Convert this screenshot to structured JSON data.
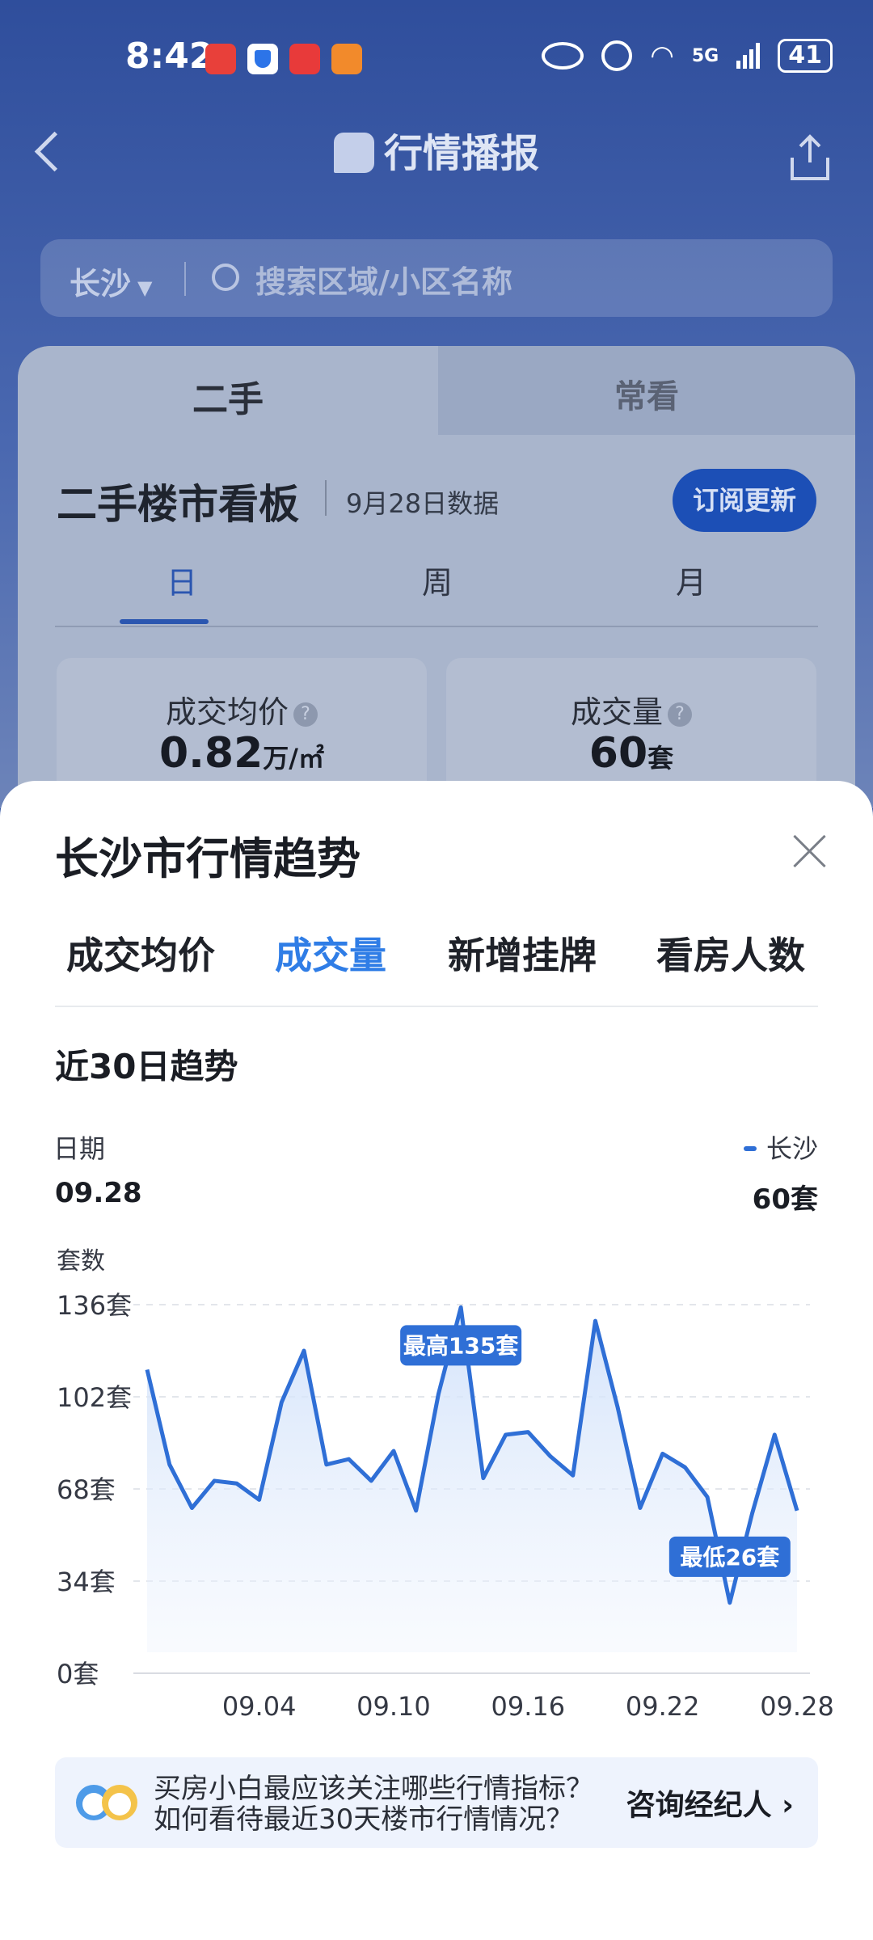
{
  "status_bar": {
    "time": "8:42",
    "network": "5G",
    "battery": "41"
  },
  "header": {
    "title": "行情播报"
  },
  "search": {
    "city": "长沙",
    "placeholder": "搜索区域/小区名称"
  },
  "card": {
    "tabs": [
      {
        "label": "二手"
      },
      {
        "label": "常看"
      }
    ],
    "board_title": "二手楼市看板",
    "board_date": "9月28日数据",
    "subscribe_label": "订阅更新",
    "periods": [
      {
        "label": "日"
      },
      {
        "label": "周"
      },
      {
        "label": "月"
      }
    ],
    "metrics": [
      {
        "label": "成交均价",
        "value": "0.82",
        "unit": "万/㎡"
      },
      {
        "label": "成交量",
        "value": "60",
        "unit": "套"
      }
    ]
  },
  "sheet": {
    "title": "长沙市行情趋势",
    "metric_tabs": [
      {
        "label": "成交均价"
      },
      {
        "label": "成交量"
      },
      {
        "label": "新增挂牌"
      },
      {
        "label": "看房人数"
      }
    ],
    "active_tab": "成交量",
    "trend_title": "近30日趋势",
    "date_label": "日期",
    "date_value": "09.28",
    "legend_label": "长沙",
    "legend_value": "60套"
  },
  "chart_data": {
    "type": "area",
    "ylabel": "套数",
    "yticks": [
      "136套",
      "102套",
      "68套",
      "34套",
      "0套"
    ],
    "ylim": [
      0,
      136
    ],
    "xtick_labels": [
      "09.04",
      "09.10",
      "09.16",
      "09.22",
      "09.28"
    ],
    "xticks": [
      "09.04",
      "09.10",
      "09.16",
      "09.22",
      "09.28"
    ],
    "grid": true,
    "series": [
      {
        "name": "长沙",
        "color": "#2f6fd6",
        "x": [
          "08.30",
          "08.31",
          "09.01",
          "09.02",
          "09.03",
          "09.04",
          "09.05",
          "09.06",
          "09.07",
          "09.08",
          "09.09",
          "09.10",
          "09.11",
          "09.12",
          "09.13",
          "09.14",
          "09.15",
          "09.16",
          "09.17",
          "09.18",
          "09.19",
          "09.20",
          "09.21",
          "09.22",
          "09.23",
          "09.24",
          "09.25",
          "09.26",
          "09.27",
          "09.28"
        ],
        "values": [
          112,
          77,
          61,
          71,
          70,
          64,
          100,
          119,
          77,
          79,
          71,
          82,
          60,
          103,
          135,
          72,
          88,
          89,
          80,
          73,
          130,
          98,
          61,
          81,
          76,
          65,
          26,
          59,
          88,
          60
        ]
      }
    ],
    "annotations": [
      {
        "label": "最高135套",
        "x": "09.13",
        "value": 135
      },
      {
        "label": "最低26套",
        "x": "09.25",
        "value": 26
      }
    ]
  },
  "banner": {
    "text_line1": "买房小白最应该关注哪些行情指标？",
    "text_line2": "如何看待最近30天楼市行情情况？",
    "cta": "咨询经纪人"
  },
  "colors": {
    "accent": "#2f7de6",
    "line": "#2f6fd6",
    "subscribe": "#1c4fb6"
  }
}
